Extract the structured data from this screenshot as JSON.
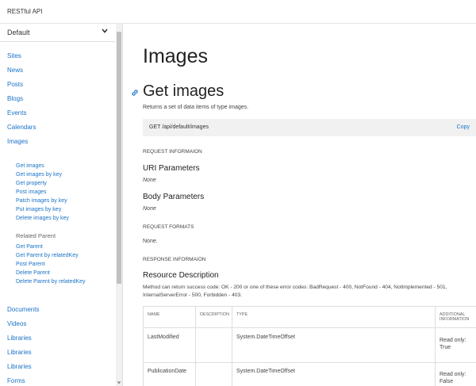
{
  "app": {
    "title": "RESTful API"
  },
  "sidebar": {
    "selected_version": "Default",
    "top_items": [
      "Sites",
      "News",
      "Posts",
      "Blogs",
      "Events",
      "Calendars",
      "Images"
    ],
    "operations": [
      "Get images",
      "Get images by key",
      "Get property",
      "Post images",
      "Patch images by key",
      "Put images by key",
      "Delete images by key"
    ],
    "related_heading": "Related Parent",
    "related_ops": [
      "Get Parent",
      "Get Parent by relatedKey",
      "Post Parent",
      "Delete Parent",
      "Delete Parent by relatedKey"
    ],
    "bottom_items": [
      "Documents",
      "Videos",
      "Libraries",
      "Libraries",
      "Libraries",
      "Forms"
    ]
  },
  "main": {
    "page_title": "Images",
    "section_title": "Get images",
    "section_desc": "Returns a set of data items of type images.",
    "endpoint": "GET /api/default/images",
    "copy_label": "Copy",
    "request_info_label": "REQUEST INFORMAION",
    "uri_params_title": "URI Parameters",
    "uri_params_value": "None",
    "body_params_title": "Body Parameters",
    "body_params_value": "None",
    "request_formats_label": "REQUEST FORMATS",
    "request_formats_value": "None.",
    "response_info_label": "RESPONSE INFORMAION",
    "resource_desc_title": "Resource Description",
    "resource_desc_text": "Method can return success code: OK - 200 or one of these error codes: BadRequest - 400, NotFound - 404, NotImplemented - 501, InternalServerError - 500, Forbidden - 403.",
    "table": {
      "headers": [
        "NAME",
        "DESCRIPTION",
        "TYPE",
        "ADDITIONAL INFORMATION"
      ],
      "rows": [
        {
          "name": "LastModified",
          "description": "",
          "type": "System.DateTimeOffset",
          "info": "Read only: True"
        },
        {
          "name": "PublicationDate",
          "description": "",
          "type": "System.DateTimeOffset",
          "info": "Read only: False"
        }
      ]
    }
  },
  "colors": {
    "link": "#1a73c8",
    "endpoint_bg": "#f1f1f1",
    "border": "#dddddd"
  }
}
